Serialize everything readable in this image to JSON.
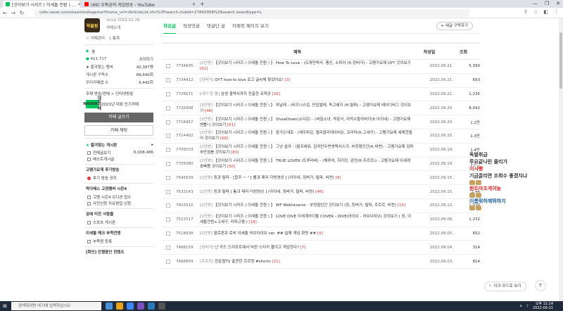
{
  "browser": {
    "tabs": [
      {
        "label": "[갓이보기 시리즈 ( 이세돌 전원 ) ...",
        "color": "#03c75a",
        "active": true
      },
      {
        "label": "(49) 우왁굳의 게임방송 - YouTube",
        "color": "#ff0000",
        "active": false
      }
    ],
    "url": "cafe.naver.com/steamindiegame?iframe_url=/ArticleList.nhn%3Fsearch.clubid=27842958%26search.boardtype=L"
  },
  "sidebar": {
    "logo_text": "왁물원",
    "since": "since 2015.02.26.",
    "cafe_info": "카페소개",
    "mgmt": [
      "☆ 카페관리",
      "▯ 통계"
    ],
    "rank": {
      "label": "숲",
      "members": "411,717",
      "invite": "초대하기"
    },
    "stats": [
      {
        "label": "★ 즐겨찾는 멤버",
        "value": "42,387명"
      },
      {
        "label": "게시판 구독수",
        "value": "69,640회"
      },
      {
        "label": "우리카페앱 수",
        "value": "6,442회"
      }
    ],
    "topic": "주제  방송/연예 > 인터넷방송",
    "badge": {
      "line1": "NAVER",
      "line2": "대표카페",
      "text": "2021년 대표 인기카페"
    },
    "write_button": "카페 글쓰기",
    "chat_button": "카페 채팅",
    "fav_title": "즐겨찾는 게시판",
    "fav_items": [
      {
        "label": "전체글보기",
        "value": "6,008,486"
      },
      {
        "label": "베스트게시글",
        "value": ""
      }
    ],
    "menus": [
      {
        "head": "고멤가요제 후기방송",
        "items": [
          "후기 방송 공지"
        ]
      },
      {
        "head": "락다베스 고정멤버 시즌4",
        "items": [
          "고멤 시즌4 오디션 접수",
          "사전신청 자유편집 신청"
        ]
      },
      {
        "head": "공에 미친 사람들",
        "items": [
          "스포츠 게시판"
        ]
      },
      {
        "head": "이세돌 메크 부족전쟁",
        "items": [
          "부족원 등록"
        ]
      },
      {
        "head": "[확인] 진행중인 컨텐츠",
        "items": []
      }
    ]
  },
  "main": {
    "tabs": [
      "작성글",
      "작성댓글",
      "댓글단 글",
      "카페북 페이지 보기"
    ],
    "subscribe": "+ 새글 구독하기",
    "headers": {
      "title": "제목",
      "author": "작성일",
      "views": "조회"
    },
    "rows": [
      {
        "no": "7734695",
        "tag": "[2인방]",
        "title": "【갓이보기 시리즈 ( 이세돌 전원 ) 】 How To Love - (도파민박사, 풍신, 소피아 (ft.징버거) - 고멤가요제 OYT 갓이보기",
        "cmt": "[62]",
        "date": "2022.09.21.",
        "views": "5,390"
      },
      {
        "no": "7734412",
        "tag": "[징버거]",
        "title": "OYT how to love 로고 글씨체 찾았어요!",
        "cmt": "[3]",
        "date": "2022.09.21.",
        "views": "693"
      },
      {
        "no": "7726671",
        "tag": "[내가 한 풍]",
        "title": "삼생 결력사까지 진출한 유학공",
        "cmt": "[16]",
        "date": "2022.09.21.",
        "views": "1,235"
      },
      {
        "no": "7720308",
        "tag": "[2인방]",
        "title": "【갓이보기 시리즈 ( 이세돌 전원 ) 】 피날레 - (비즈니스킴, 단답벌레, 독고혜지 (ft.릴파) - 고멤가요제 레이디버그 갓이보기",
        "cmt": "[46]",
        "date": "2022.09.20.",
        "views": "8,042"
      },
      {
        "no": "7716457",
        "tag": "[2인방]",
        "title": "【갓이보기 시리즈 ( 이세돌 전원 ) 】 ShowDown(쇼다운) - (비밀소녀, 곽춘식, 이덕수할아버지(ft.아이네) - 고멤가요제 벤틀니 갓이보기",
        "cmt": "[61]",
        "date": "2022.09.20.",
        "views": "1.2만"
      },
      {
        "no": "7714482",
        "tag": "[2인방]",
        "title": "【갓이보기 시리즈 ( 이세돌 전원 ) 】 맘가는대로 - (새우튀김, 캘리칼리데이비슨, 프리터(ft.고세구) - 고멤가요제 세레한캘리 갓이보기",
        "cmt": "[68]",
        "date": "2022.09.20.",
        "views": "1.3만"
      },
      {
        "no": "7709533",
        "tag": "[2인방]",
        "title": "【갓이보기 시리즈 ( 이세돌 전원 ) 】 그냥 살아 - (랄프에뮤, 김치만두번영택사스가, 부정형인간(ft.비챤) - 고멤가요제 김파부만점봉 갓이보기",
        "cmt": "[83]",
        "date": "2022.09.19.",
        "views": "1.4만"
      },
      {
        "no": "7705080",
        "tag": "[2인방]",
        "title": "【갓이보기 시리즈 ( 이세돌 전원 ) 】 TRUE LOVER (트루러버) - (해루석, 히키킹, 권민(ft.주르르)) - 고멤가요제 이세계호빠쯤 갓이보기",
        "cmt": "[50]",
        "date": "2022.09.19.",
        "views": "1.2만"
      },
      {
        "no": "7645639",
        "tag": "[2인방]",
        "title": "징과 릴파 - [합주 ~ \" [ 롤과 제리 더빙영상 ] (아이네, 징버거, 릴파, 비챤)",
        "cmt": "[9]",
        "date": "2022.09.15.",
        "views": "1,5"
      },
      {
        "no": "7633143",
        "tag": "[2인방]",
        "title": "징과 릴파 [ 톰과 제리 더빙영상 ] (아이네, 징버거, 릴파, 비챤)",
        "cmt": "[46]",
        "date": "2022.09.15.",
        "views": "2,44"
      },
      {
        "no": "7603510",
        "tag": "[2인방]",
        "title": "【갓이보기 시리즈 ( 이세돌 전원 ) 】 WF Waktaverse - 부정형인간 갓이보기 (징, 징버거, 릴파, 주르르, 비챤)",
        "cmt": "[15]",
        "date": "2022.09.12.",
        "views": "1,036"
      },
      {
        "no": "7522517",
        "tag": "[2인방]",
        "title": "【갓이보기 시리즈 ( 이세돌 전원 ) 】 LOVE DIVE 이세계아이돌 COVER - DIVE(아이브 - 러브다이브) 갓이보기 ( 징, 이세돌전원+고세구, 리퍼고멤 )",
        "cmt": "[18]",
        "date": "2022.09.06.",
        "views": "1,232"
      },
      {
        "no": "7518938",
        "tag": "[2인방]",
        "title": "팔로판프 로비 이세돌 러브다이브 ver. ## 실제 게임 화면 ##",
        "cmt": "[9]",
        "date": "2022.09.05.",
        "views": "652"
      },
      {
        "no": "7488159",
        "tag": "[징버거]",
        "title": "난 카드 드리프트에서 비챤 스티커 붙이고 게임한다?",
        "cmt": "[7]",
        "date": "2022.09.04.",
        "views": "314"
      },
      {
        "no": "7486859",
        "tag": "[주르르]",
        "title": "한문철TV 출연한 르르땅 #shorts",
        "cmt": "[11]",
        "date": "2022.09.03.",
        "views": "814"
      }
    ]
  },
  "overlay": {
    "lines": [
      {
        "text": "독벌취급",
        "color": "#333333"
      },
      {
        "text": "루요같나린 줄리가",
        "color": "#333333"
      },
      {
        "text": "이사빵",
        "color": "#e02020"
      },
      {
        "text": "기금끌리면 조회수 좋겠지냐",
        "color": "#333333"
      },
      {
        "text": "원트마조게이농",
        "color": "#e02020"
      },
      {
        "text": "이름뭐하깨뛰하지",
        "color": "#1a5fa0"
      }
    ]
  },
  "darkmode_label": "다크 모드로 보기",
  "taskbar": {
    "search": "검색하려면 여기에 입력하십시오",
    "time": "오후 11:14",
    "date": "2022-09-21"
  },
  "colors": {
    "accent": "#03c75a",
    "comment": "#e33333"
  }
}
